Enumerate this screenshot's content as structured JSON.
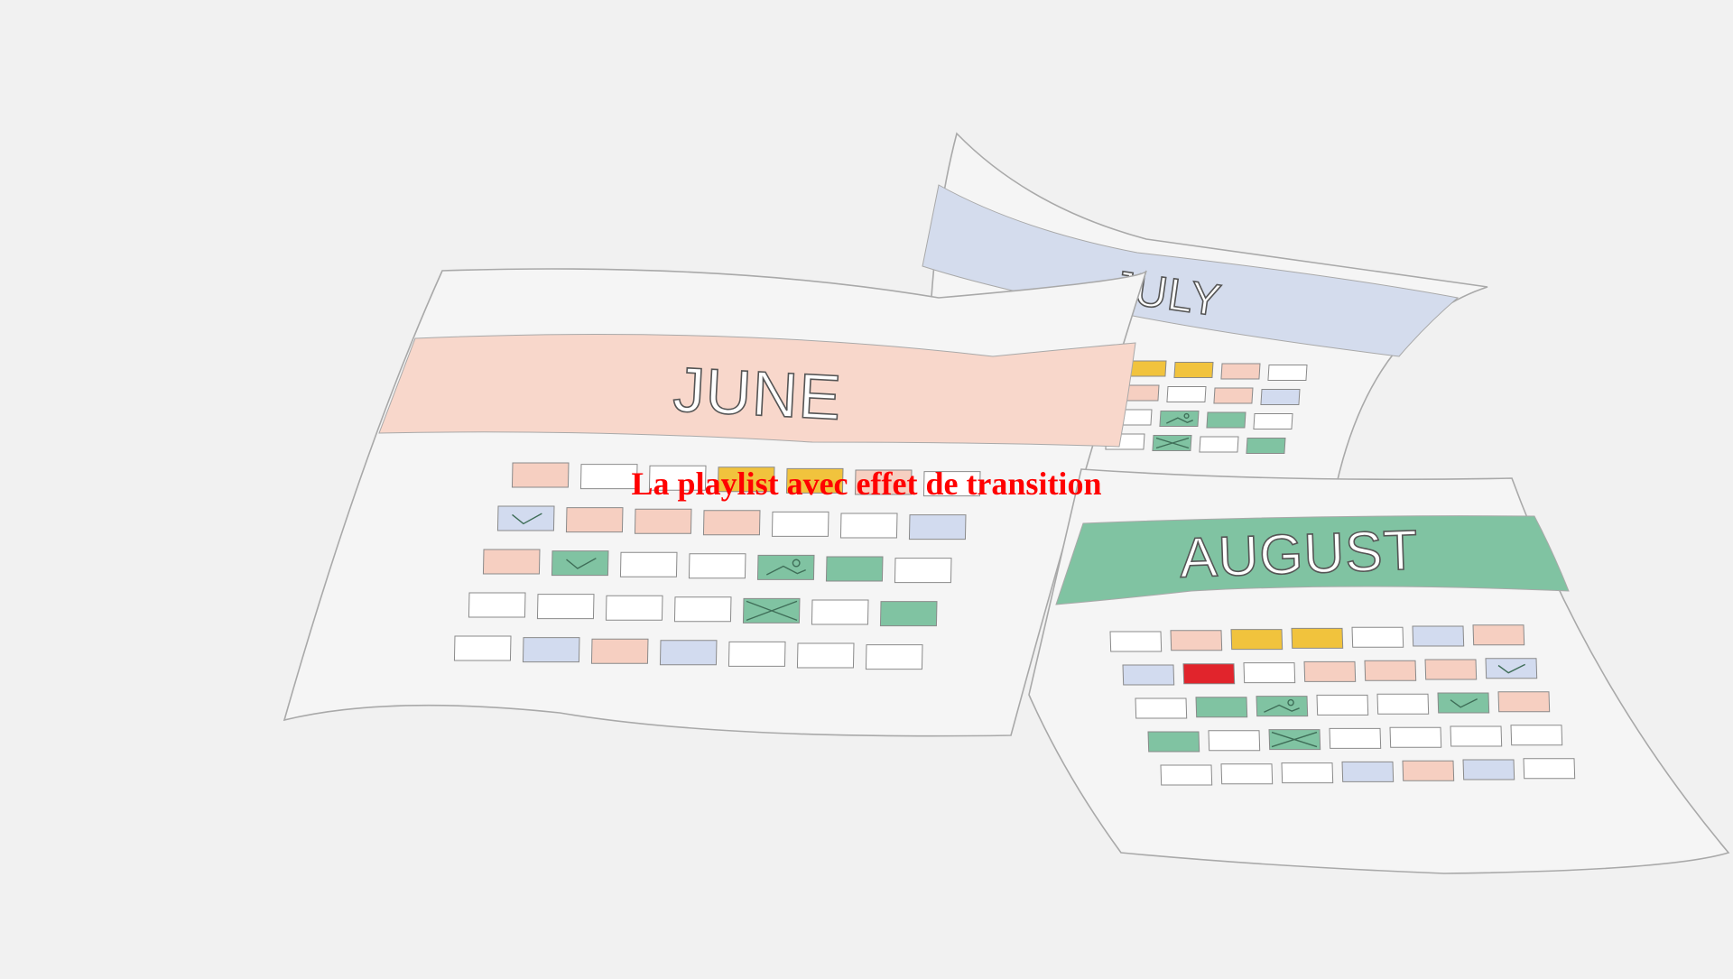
{
  "colors": {
    "background": "#f1f1f1",
    "paper": "#f5f5f5",
    "outline": "#a9a9a9",
    "june_header": "#f8d7cb",
    "july_header": "#d4dced",
    "august_header": "#80c3a2",
    "cell_peach": "#f6cfc1",
    "cell_white": "#ffffff",
    "cell_yellow": "#f1c33d",
    "cell_blue": "#d2dbef",
    "cell_green": "#80c3a2",
    "cell_red": "#e1242c",
    "caption": "#ff0000"
  },
  "calendars": [
    {
      "key": "july",
      "title": "JULY",
      "header_color": "july_header",
      "rows": [
        [
          "yellow",
          "yellow",
          "peach",
          "white"
        ],
        [
          "peach",
          "white",
          "peach",
          "blue"
        ],
        [
          "white",
          "green-photo",
          "green",
          "white"
        ],
        [
          "white",
          "green-x",
          "white",
          "green"
        ]
      ]
    },
    {
      "key": "june",
      "title": "JUNE",
      "header_color": "june_header",
      "rows": [
        [
          "peach",
          "white",
          "white",
          "yellow",
          "yellow",
          "peach",
          "white"
        ],
        [
          "blue-check",
          "peach",
          "peach",
          "peach",
          "white",
          "white",
          "blue"
        ],
        [
          "peach",
          "green-check",
          "white",
          "white",
          "green-photo",
          "green",
          "white"
        ],
        [
          "white",
          "white",
          "white",
          "white",
          "green-x",
          "white",
          "green"
        ],
        [
          "white",
          "blue",
          "peach",
          "blue",
          "white",
          "white",
          "white"
        ]
      ]
    },
    {
      "key": "august",
      "title": "AUGUST",
      "header_color": "august_header",
      "rows": [
        [
          "white",
          "peach",
          "yellow",
          "yellow",
          "white",
          "blue",
          "peach"
        ],
        [
          "blue",
          "red",
          "white",
          "peach",
          "peach",
          "peach",
          "blue-check"
        ],
        [
          "white",
          "green",
          "green-photo",
          "white",
          "white",
          "green-check",
          "peach"
        ],
        [
          "green",
          "white",
          "green-x",
          "white",
          "white",
          "white",
          "white"
        ],
        [
          "white",
          "white",
          "white",
          "blue",
          "peach",
          "blue",
          "white"
        ]
      ]
    }
  ],
  "caption": {
    "text": "La playlist avec effet de transition"
  }
}
